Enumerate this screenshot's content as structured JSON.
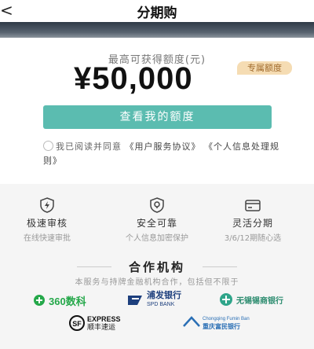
{
  "header": {
    "back_glyph": "<",
    "title": "分期购"
  },
  "quota": {
    "label": "最高可获得额度(元)",
    "amount": "¥50,000",
    "badge": "专属额度",
    "button": "查看我的额度"
  },
  "agreement": {
    "prefix": "我已阅读并同意",
    "link1": "《用户服务协议》",
    "link2": "《个人信息处理规则》"
  },
  "features": [
    {
      "title": "极速审核",
      "desc": "在线快速审批",
      "icon": "shield-bolt-icon"
    },
    {
      "title": "安全可靠",
      "desc": "个人信息加密保护",
      "icon": "shield-pin-icon"
    },
    {
      "title": "灵活分期",
      "desc": "3/6/12期随心选",
      "icon": "card-icon"
    }
  ],
  "partners": {
    "title": "合作机构",
    "desc": "本服务与持牌金融机构合作，包括但不限于",
    "logos": [
      {
        "name": "360数科",
        "text": "360数科"
      },
      {
        "name": "浦发银行",
        "text": "浦发银行",
        "sub": "SPD BANK"
      },
      {
        "name": "无锡锡商银行",
        "text": "无锡锡商银行"
      },
      {
        "name": "顺丰速运",
        "text": "EXPRESS",
        "sub": "顺丰速运"
      },
      {
        "name": "重庆富民银行",
        "text": "Chongqing Fumin Ban",
        "sub": "重庆富民银行"
      }
    ]
  },
  "colors": {
    "accent": "#5bbcb0",
    "badge_bg": "#f5dcb3",
    "badge_text": "#a06a2c"
  }
}
